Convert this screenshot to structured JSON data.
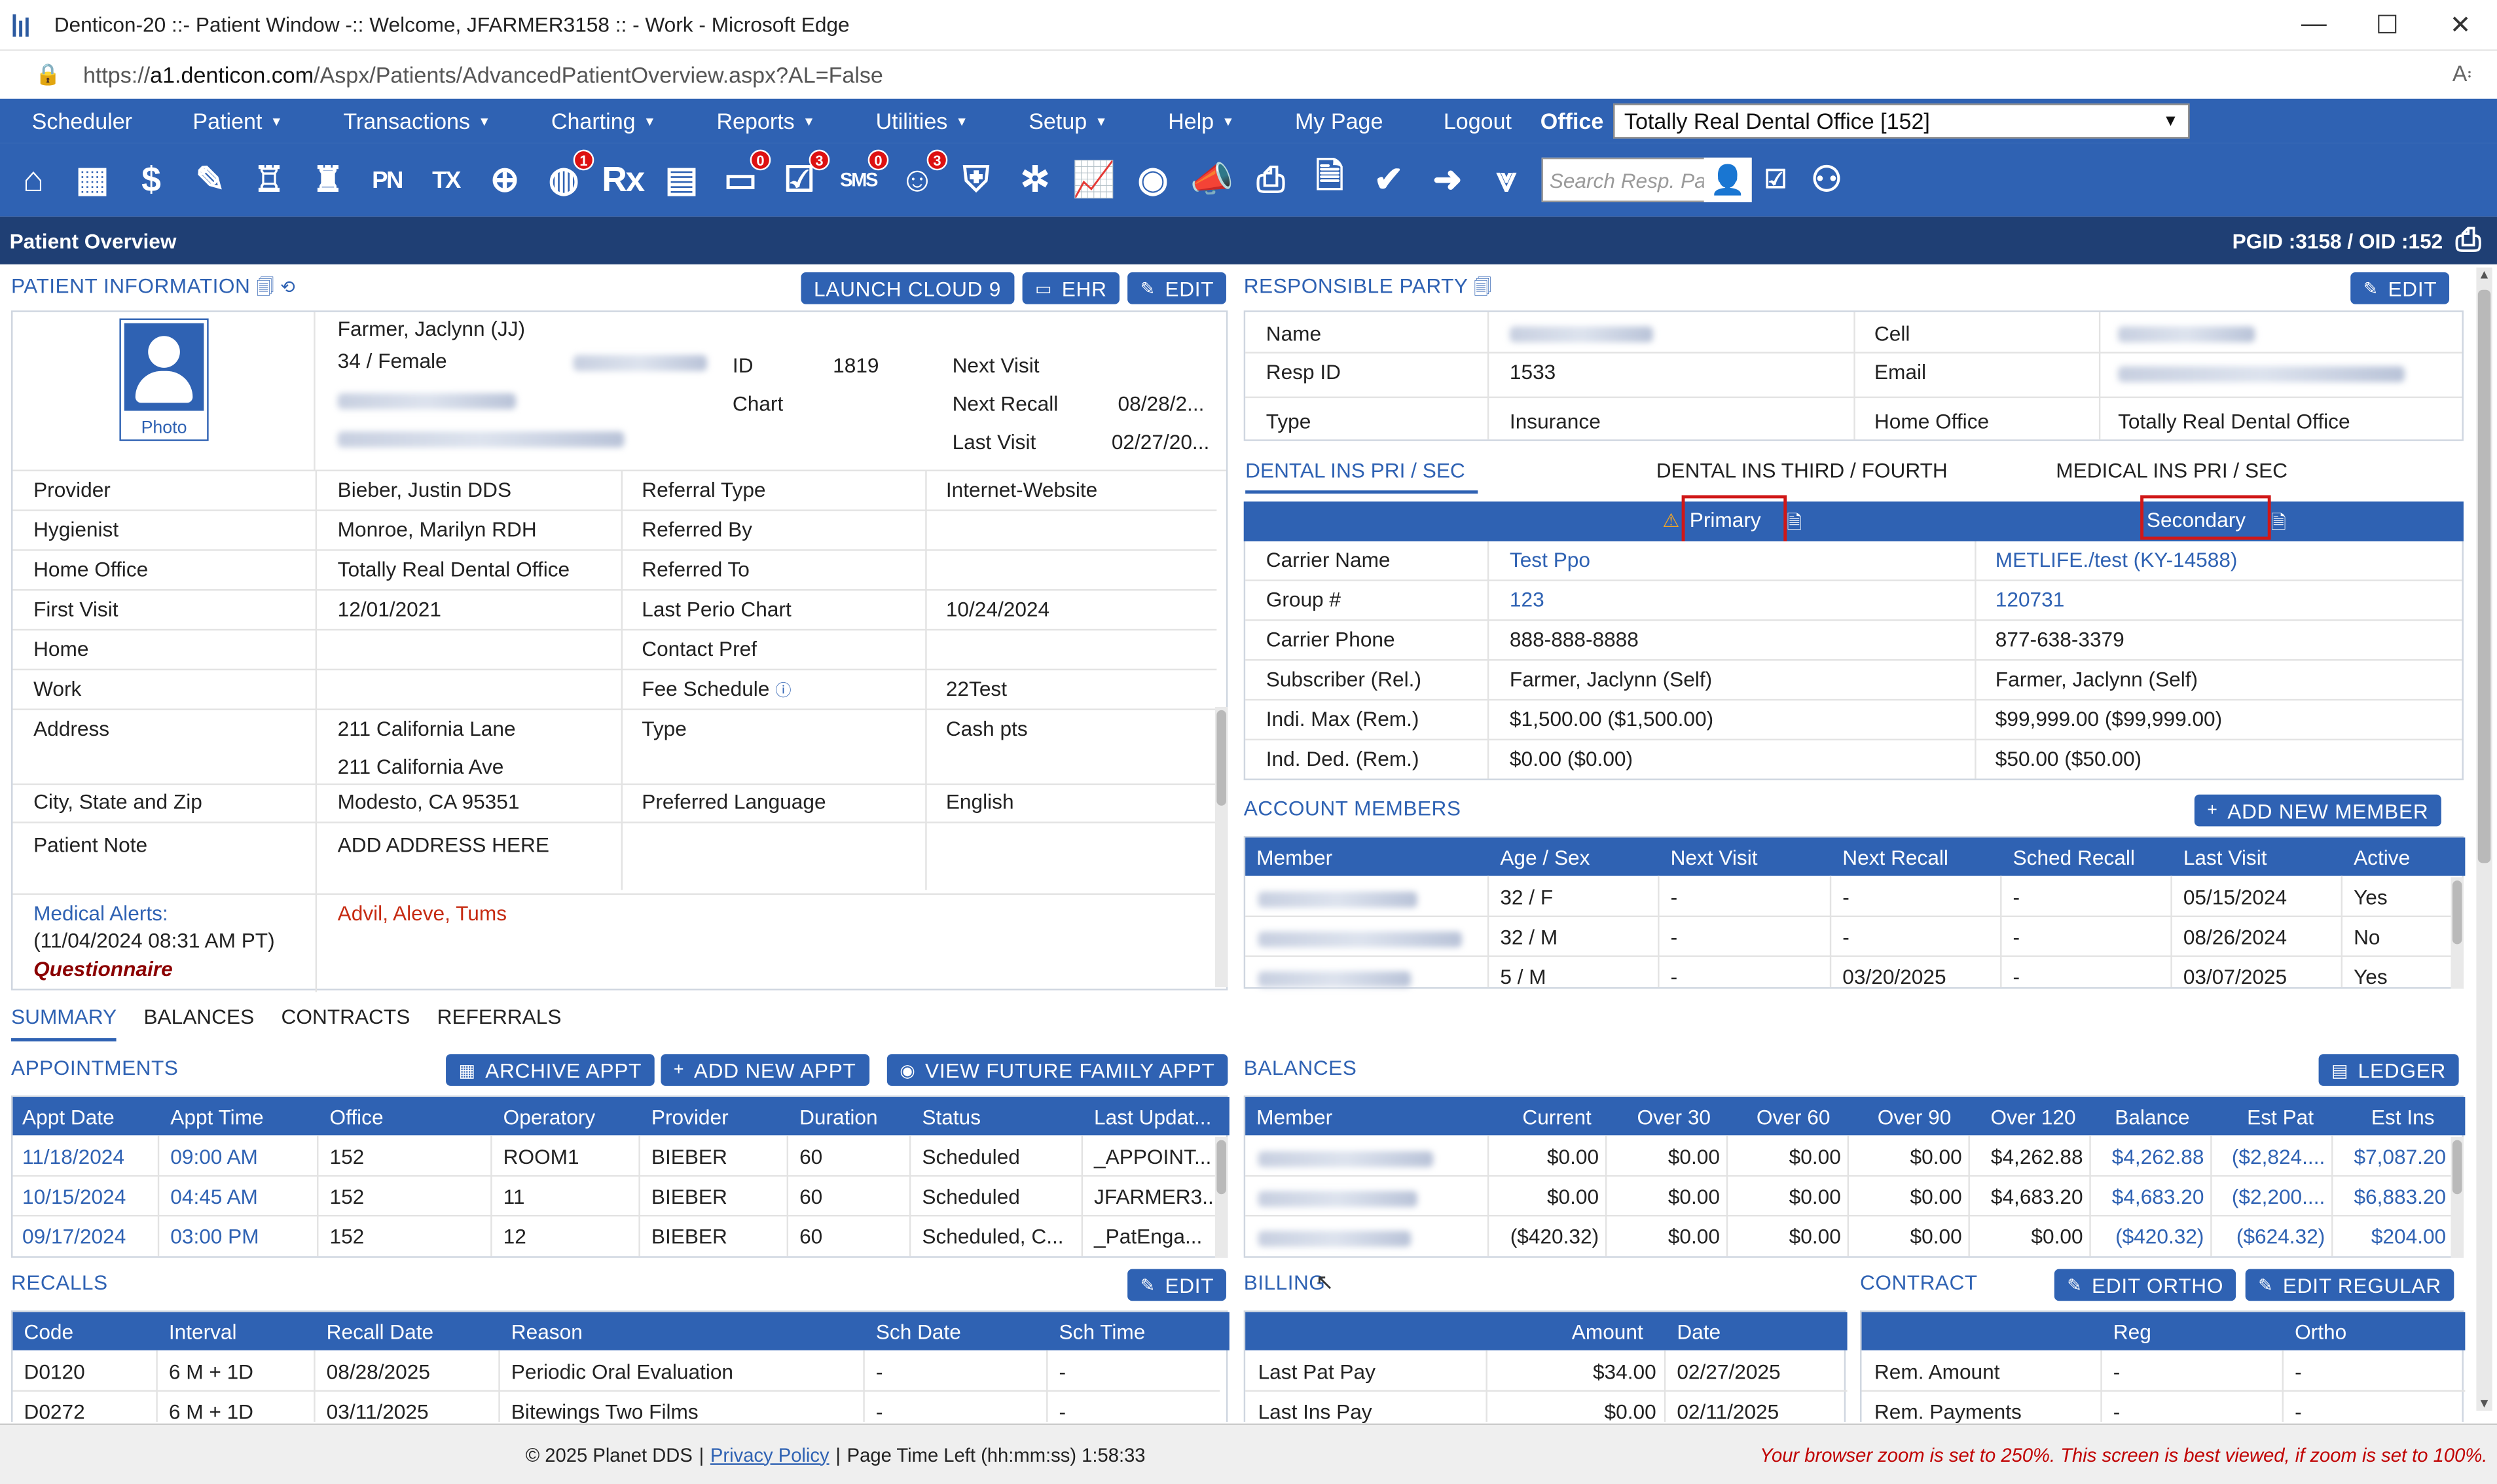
{
  "window": {
    "title": "Denticon-20 ::- Patient Window -:: Welcome, JFARMER3158 :: - Work - Microsoft Edge",
    "minimize": "—",
    "maximize": "☐",
    "close": "✕"
  },
  "address": {
    "protocol": "https://",
    "host": "a1.denticon.com",
    "path": "/Aspx/Patients/AdvancedPatientOverview.aspx?AL=False"
  },
  "menu": {
    "items": [
      "Scheduler",
      "Patient",
      "Transactions",
      "Charting",
      "Reports",
      "Utilities",
      "Setup",
      "Help",
      "My Page",
      "Logout"
    ],
    "office_label": "Office",
    "office_value": "Totally Real Dental Office [152]"
  },
  "toolbar": {
    "search_placeholder": "Search Resp. Party",
    "badges": {
      "globe": "1",
      "chat": "0",
      "tasks": "3",
      "sms": "0",
      "alerts": "3"
    },
    "labels": {
      "pn": "PN",
      "tx": "TX",
      "rx": "Rx",
      "sms": "SMS"
    }
  },
  "page": {
    "title": "Patient Overview",
    "ids": "PGID :3158  /  OID :152"
  },
  "patient": {
    "section_title": "PATIENT INFORMATION",
    "btn_launch": "LAUNCH CLOUD 9",
    "btn_ehr": "EHR",
    "btn_edit": "EDIT",
    "photo_label": "Photo",
    "name": "Farmer, Jaclynn (JJ)",
    "age_sex": "34 / Female",
    "id_label": "ID",
    "id_value": "1819",
    "chart_label": "Chart",
    "next_visit_label": "Next Visit",
    "next_visit": "",
    "next_recall_label": "Next Recall",
    "next_recall": "08/28/2...",
    "last_visit_label": "Last Visit",
    "last_visit": "02/27/20...",
    "rows": [
      [
        "Provider",
        "Bieber, Justin DDS",
        "Referral Type",
        "Internet-Website"
      ],
      [
        "Hygienist",
        "Monroe, Marilyn RDH",
        "Referred By",
        ""
      ],
      [
        "Home Office",
        "Totally Real Dental Office",
        "Referred To",
        ""
      ],
      [
        "First Visit",
        "12/01/2021",
        "Last Perio Chart",
        "10/24/2024"
      ],
      [
        "Home",
        "",
        "Contact Pref",
        ""
      ],
      [
        "Work",
        "",
        "Fee Schedule",
        "22Test"
      ]
    ],
    "address_label": "Address",
    "address1": "211 California Lane",
    "address2": "211 California Ave",
    "type_label": "Type",
    "type_value": "Cash pts",
    "city_label": "City, State and Zip",
    "city_value": "Modesto, CA 95351",
    "lang_label": "Preferred Language",
    "lang_value": "English",
    "note_label": "Patient Note",
    "note_value": "ADD ADDRESS HERE",
    "alerts_label": "Medical Alerts:",
    "alerts_date": "(11/04/2024 08:31 AM PT)",
    "questionnaire": "Questionnaire",
    "alerts_value": "Advil, Aleve, Tums"
  },
  "resp": {
    "section_title": "RESPONSIBLE PARTY",
    "btn_edit": "EDIT",
    "name_label": "Name",
    "cell_label": "Cell",
    "respid_label": "Resp ID",
    "respid_value": "1533",
    "email_label": "Email",
    "type_label": "Type",
    "type_value": "Insurance",
    "home_office_label": "Home Office",
    "home_office_value": "Totally Real Dental Office"
  },
  "ins": {
    "tabs": [
      "DENTAL INS PRI / SEC",
      "DENTAL INS THIRD / FOURTH",
      "MEDICAL INS PRI / SEC"
    ],
    "primary": "Primary",
    "secondary": "Secondary",
    "rows": [
      [
        "Carrier Name",
        "Test Ppo",
        "METLIFE./test (KY-14588)"
      ],
      [
        "Group #",
        "123",
        "120731"
      ],
      [
        "Carrier Phone",
        "888-888-8888",
        "877-638-3379"
      ],
      [
        "Subscriber (Rel.)",
        "Farmer, Jaclynn (Self)",
        "Farmer, Jaclynn (Self)"
      ],
      [
        "Indi. Max (Rem.)",
        "$1,500.00 ($1,500.00)",
        "$99,999.00 ($99,999.00)"
      ],
      [
        "Ind. Ded. (Rem.)",
        "$0.00 ($0.00)",
        "$50.00 ($50.00)"
      ]
    ]
  },
  "members": {
    "section_title": "ACCOUNT MEMBERS",
    "btn_add": "ADD NEW MEMBER",
    "headers": [
      "Member",
      "Age / Sex",
      "Next Visit",
      "Next Recall",
      "Sched Recall",
      "Last Visit",
      "Active"
    ],
    "rows": [
      [
        "32 / F",
        "-",
        "-",
        "-",
        "05/15/2024",
        "Yes"
      ],
      [
        "32 / M",
        "-",
        "-",
        "-",
        "08/26/2024",
        "No"
      ],
      [
        "5 / M",
        "-",
        "03/20/2025",
        "-",
        "03/07/2025",
        "Yes"
      ]
    ]
  },
  "tabs": [
    "SUMMARY",
    "BALANCES",
    "CONTRACTS",
    "REFERRALS"
  ],
  "appointments": {
    "section_title": "APPOINTMENTS",
    "btn_archive": "ARCHIVE APPT",
    "btn_add": "ADD NEW APPT",
    "btn_future": "VIEW FUTURE FAMILY APPT",
    "headers": [
      "Appt Date",
      "Appt Time",
      "Office",
      "Operatory",
      "Provider",
      "Duration",
      "Status",
      "Last Updat..."
    ],
    "rows": [
      [
        "11/18/2024",
        "09:00 AM",
        "152",
        "ROOM1",
        "BIEBER",
        "60",
        "Scheduled",
        "_APPOINT..."
      ],
      [
        "10/15/2024",
        "04:45 AM",
        "152",
        "11",
        "BIEBER",
        "60",
        "Scheduled",
        "JFARMER3..."
      ],
      [
        "09/17/2024",
        "03:00 PM",
        "152",
        "12",
        "BIEBER",
        "60",
        "Scheduled, C...",
        "_PatEnga..."
      ]
    ]
  },
  "balances": {
    "section_title": "BALANCES",
    "btn_ledger": "LEDGER",
    "headers": [
      "Member",
      "Current",
      "Over 30",
      "Over 60",
      "Over 90",
      "Over 120",
      "Balance",
      "Est Pat",
      "Est Ins"
    ],
    "rows": [
      [
        "$0.00",
        "$0.00",
        "$0.00",
        "$0.00",
        "$4,262.88",
        "$4,262.88",
        "($2,824....",
        "$7,087.20"
      ],
      [
        "$0.00",
        "$0.00",
        "$0.00",
        "$0.00",
        "$4,683.20",
        "$4,683.20",
        "($2,200....",
        "$6,883.20"
      ],
      [
        "($420.32)",
        "$0.00",
        "$0.00",
        "$0.00",
        "$0.00",
        "($420.32)",
        "($624.32)",
        "$204.00"
      ]
    ]
  },
  "recalls": {
    "section_title": "RECALLS",
    "btn_edit": "EDIT",
    "headers": [
      "Code",
      "Interval",
      "Recall Date",
      "Reason",
      "Sch Date",
      "Sch Time"
    ],
    "rows": [
      [
        "D0120",
        "6 M + 1D",
        "08/28/2025",
        "Periodic Oral Evaluation",
        "-",
        "-"
      ],
      [
        "D0272",
        "6 M + 1D",
        "03/11/2025",
        "Bitewings Two Films",
        "-",
        "-"
      ]
    ]
  },
  "billing": {
    "section_title": "BILLING",
    "headers": [
      "Amount",
      "Date"
    ],
    "rows": [
      [
        "Last Pat Pay",
        "$34.00",
        "02/27/2025"
      ],
      [
        "Last Ins Pay",
        "$0.00",
        "02/11/2025"
      ]
    ]
  },
  "contract": {
    "section_title": "CONTRACT",
    "btn_ortho": "EDIT ORTHO",
    "btn_regular": "EDIT REGULAR",
    "headers": [
      "Reg",
      "Ortho"
    ],
    "rows": [
      [
        "Rem. Amount",
        "-",
        "-"
      ],
      [
        "Rem. Payments",
        "-",
        "-"
      ]
    ]
  },
  "footer": {
    "copyright": "© 2025 Planet DDS",
    "privacy": "Privacy Policy",
    "time_left": "Page Time Left (hh:mm:ss) 1:58:33",
    "zoom_warning": "Your browser zoom is set to 250%. This screen is best viewed, if zoom is set to 100%."
  },
  "colors": {
    "brand": "#2f62b3",
    "header_dark": "#1f3f74",
    "alert_red": "#d01717",
    "footer_warning": "#c00000"
  }
}
